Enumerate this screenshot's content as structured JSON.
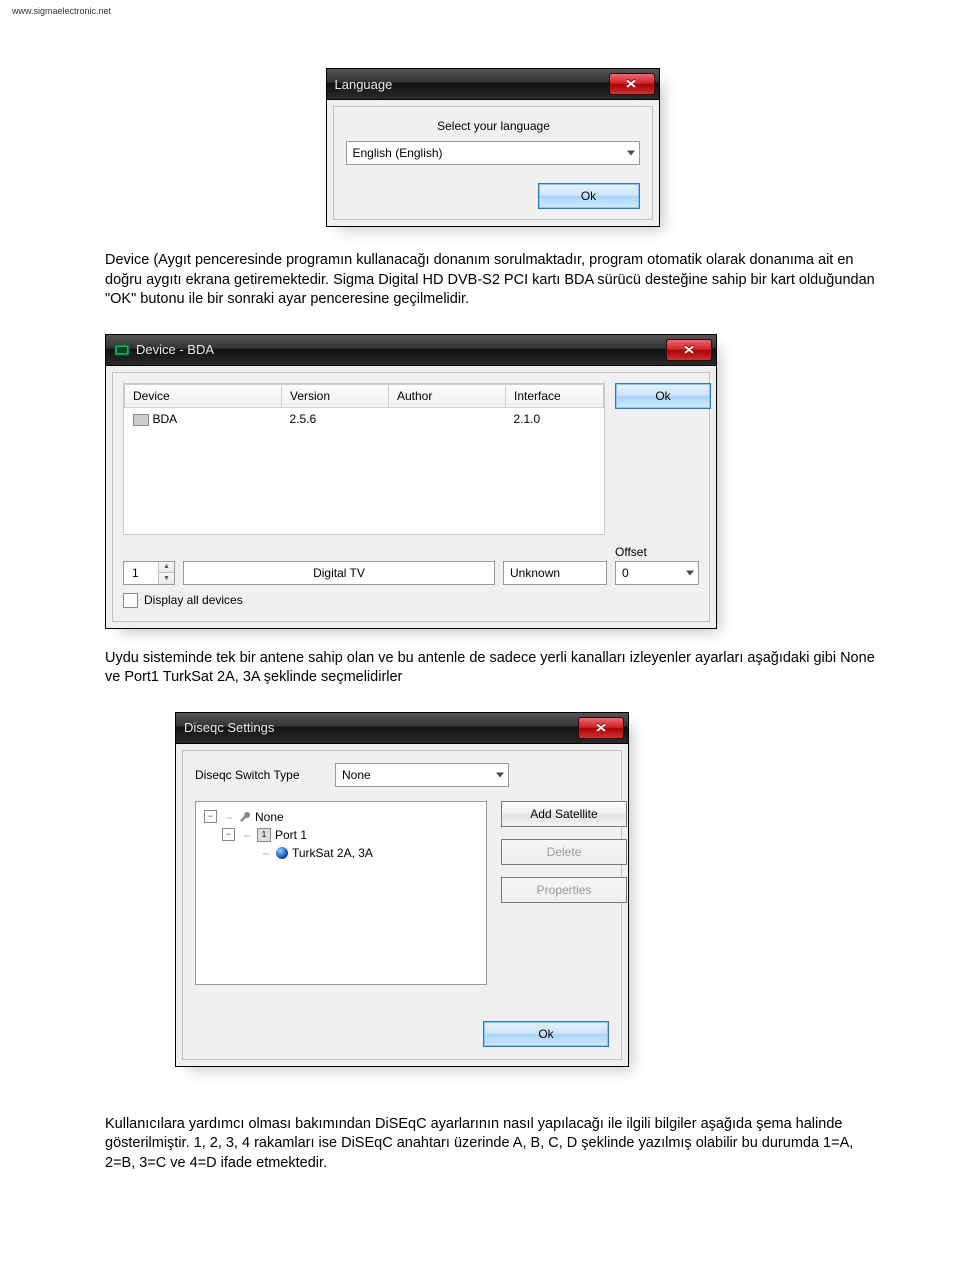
{
  "page_url": "www.sigmaelectronic.net",
  "paragraphs": {
    "p1": "Device (Aygıt penceresinde programın kullanacağı donanım sorulmaktadır, program otomatik olarak donanıma ait en doğru aygıtı ekrana getiremektedir. Sigma Digital HD DVB-S2 PCI kartı BDA sürücü desteğine sahip bir kart olduğundan \"OK\" butonu ile bir sonraki ayar penceresine geçilmelidir.",
    "p2": "Uydu sisteminde tek bir antene sahip olan ve bu antenle de sadece yerli kanalları izleyenler ayarları aşağıdaki gibi None ve Port1 TurkSat 2A, 3A şeklinde seçmelidirler",
    "p3": "Kullanıcılara yardımcı olması bakımından DiSEqC ayarlarının nasıl yapılacağı ile ilgili bilgiler aşağıda şema halinde gösterilmiştir. 1, 2, 3, 4 rakamları ise DiSEqC anahtarı üzerinde A, B, C, D şeklinde yazılmış olabilir bu durumda 1=A, 2=B, 3=C ve 4=D ifade etmektedir."
  },
  "dlg_language": {
    "title": "Language",
    "label": "Select your language",
    "value": "English  (English)",
    "ok": "Ok"
  },
  "dlg_device": {
    "title": "Device - BDA",
    "headers": {
      "device": "Device",
      "version": "Version",
      "author": "Author",
      "interface": "Interface"
    },
    "row": {
      "device": "BDA",
      "version": "2.5.6",
      "author": "",
      "interface": "2.1.0"
    },
    "ok": "Ok",
    "spinner_value": "1",
    "mode": "Digital TV",
    "unknown": "Unknown",
    "offset_label": "Offset",
    "offset_value": "0",
    "display_all": "Display all devices"
  },
  "dlg_diseqc": {
    "title": "Diseqc Settings",
    "switch_label": "Diseqc Switch Type",
    "switch_value": "None",
    "tree": {
      "root": "None",
      "port": "Port 1",
      "sat": "TurkSat 2A, 3A"
    },
    "btn_add": "Add Satellite",
    "btn_delete": "Delete",
    "btn_props": "Properties",
    "btn_ok": "Ok"
  }
}
